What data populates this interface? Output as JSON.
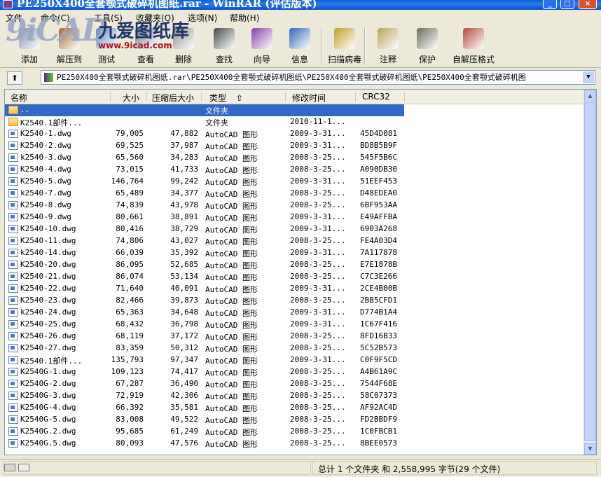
{
  "window": {
    "title": "PE250X400全套颚式破碎机图纸.rar - WinRAR (评估版本)"
  },
  "menu": [
    "文件",
    "命令(C)",
    "工具(S)",
    "收藏夹(O)",
    "选项(N)",
    "帮助(H)"
  ],
  "watermark": {
    "brand": "9iCAD",
    "name": "九爱图纸库",
    "url": "www.9icad.com"
  },
  "toolbar": {
    "buttons": [
      {
        "label": "添加",
        "icon": "add-icon",
        "color": "#7b8fb0"
      },
      {
        "label": "解压到",
        "icon": "extract-icon",
        "color": "#a36a2b"
      },
      {
        "label": "测试",
        "icon": "test-icon",
        "color": "#5f86c4"
      },
      {
        "label": "查看",
        "icon": "view-icon",
        "color": "#6a7f96"
      },
      {
        "label": "删除",
        "icon": "delete-icon",
        "color": "#8e8e8e"
      },
      {
        "label": "查找",
        "icon": "find-icon",
        "color": "#4a4a4a"
      },
      {
        "label": "向导",
        "icon": "wizard-icon",
        "color": "#8a3fa6"
      },
      {
        "label": "信息",
        "icon": "info-icon",
        "color": "#2f66b8"
      },
      {
        "label": "扫描病毒",
        "icon": "scan-virus-icon",
        "color": "#c49b2b"
      },
      {
        "label": "注释",
        "icon": "comment-icon",
        "color": "#b8a35a"
      },
      {
        "label": "保护",
        "icon": "protect-icon",
        "color": "#6b6b5a"
      },
      {
        "label": "自解压格式",
        "icon": "sfx-icon",
        "color": "#b34a3a"
      }
    ]
  },
  "address": {
    "path": "PE250X400全套颚式破碎机图纸.rar\\PE250X400全套颚式破碎机图纸\\PE250X400全套颚式破碎机图纸\\PE250X400全套颚式破碎机图"
  },
  "columns": [
    "名称",
    "大小",
    "压缩后大小",
    "类型",
    "修改时间",
    "CRC32"
  ],
  "files": [
    {
      "name": "..",
      "size": "",
      "packed": "",
      "type": "文件夹",
      "date": "",
      "crc": "",
      "icon": "folder",
      "selected": true
    },
    {
      "name": "K2540.1部件...",
      "size": "",
      "packed": "",
      "type": "文件夹",
      "date": "2010-11-1...",
      "crc": "",
      "icon": "folder"
    },
    {
      "name": "K2540-1.dwg",
      "size": "79,005",
      "packed": "47,882",
      "type": "AutoCAD 图形",
      "date": "2009-3-31...",
      "crc": "45D4D081",
      "icon": "dwg"
    },
    {
      "name": "K2540-2.dwg",
      "size": "69,525",
      "packed": "37,987",
      "type": "AutoCAD 图形",
      "date": "2009-3-31...",
      "crc": "BD8B5B9F",
      "icon": "dwg"
    },
    {
      "name": "k2540-3.dwg",
      "size": "65,560",
      "packed": "34,283",
      "type": "AutoCAD 图形",
      "date": "2008-3-25...",
      "crc": "545F5B6C",
      "icon": "dwg"
    },
    {
      "name": "K2540-4.dwg",
      "size": "73,015",
      "packed": "41,733",
      "type": "AutoCAD 图形",
      "date": "2008-3-25...",
      "crc": "A090DB30",
      "icon": "dwg"
    },
    {
      "name": "K2540-5.dwg",
      "size": "146,764",
      "packed": "99,242",
      "type": "AutoCAD 图形",
      "date": "2009-3-31...",
      "crc": "51EEF453",
      "icon": "dwg"
    },
    {
      "name": "k2540-7.dwg",
      "size": "65,489",
      "packed": "34,377",
      "type": "AutoCAD 图形",
      "date": "2008-3-25...",
      "crc": "D48EDEA0",
      "icon": "dwg"
    },
    {
      "name": "K2540-8.dwg",
      "size": "74,839",
      "packed": "43,978",
      "type": "AutoCAD 图形",
      "date": "2008-3-25...",
      "crc": "6BF953AA",
      "icon": "dwg"
    },
    {
      "name": "K2540-9.dwg",
      "size": "80,661",
      "packed": "38,891",
      "type": "AutoCAD 图形",
      "date": "2009-3-31...",
      "crc": "E49AFFBA",
      "icon": "dwg"
    },
    {
      "name": "K2540-10.dwg",
      "size": "80,416",
      "packed": "38,729",
      "type": "AutoCAD 图形",
      "date": "2009-3-31...",
      "crc": "6903A268",
      "icon": "dwg"
    },
    {
      "name": "K2540-11.dwg",
      "size": "74,806",
      "packed": "43,027",
      "type": "AutoCAD 图形",
      "date": "2008-3-25...",
      "crc": "FE4A03D4",
      "icon": "dwg"
    },
    {
      "name": "k2540-14.dwg",
      "size": "66,039",
      "packed": "35,392",
      "type": "AutoCAD 图形",
      "date": "2009-3-31...",
      "crc": "7A117878",
      "icon": "dwg"
    },
    {
      "name": "K2540-20.dwg",
      "size": "86,095",
      "packed": "52,685",
      "type": "AutoCAD 图形",
      "date": "2008-3-25...",
      "crc": "E7E1878B",
      "icon": "dwg"
    },
    {
      "name": "K2540-21.dwg",
      "size": "86,074",
      "packed": "53,134",
      "type": "AutoCAD 图形",
      "date": "2008-3-25...",
      "crc": "C7C3E266",
      "icon": "dwg"
    },
    {
      "name": "K2540-22.dwg",
      "size": "71,640",
      "packed": "40,091",
      "type": "AutoCAD 图形",
      "date": "2009-3-31...",
      "crc": "2CE4B00B",
      "icon": "dwg"
    },
    {
      "name": "K2540-23.dwg",
      "size": "82,466",
      "packed": "39,873",
      "type": "AutoCAD 图形",
      "date": "2008-3-25...",
      "crc": "2BB5CFD1",
      "icon": "dwg"
    },
    {
      "name": "k2540-24.dwg",
      "size": "65,363",
      "packed": "34,648",
      "type": "AutoCAD 图形",
      "date": "2009-3-31...",
      "crc": "D774B1A4",
      "icon": "dwg"
    },
    {
      "name": "K2540-25.dwg",
      "size": "68,432",
      "packed": "36,798",
      "type": "AutoCAD 图形",
      "date": "2009-3-31...",
      "crc": "1C67F416",
      "icon": "dwg"
    },
    {
      "name": "K2540-26.dwg",
      "size": "68,119",
      "packed": "37,172",
      "type": "AutoCAD 图形",
      "date": "2008-3-25...",
      "crc": "8FD16B33",
      "icon": "dwg"
    },
    {
      "name": "K2540-27.dwg",
      "size": "83,359",
      "packed": "50,312",
      "type": "AutoCAD 图形",
      "date": "2008-3-25...",
      "crc": "5C52B573",
      "icon": "dwg"
    },
    {
      "name": "K2540.1部件...",
      "size": "135,793",
      "packed": "97,347",
      "type": "AutoCAD 图形",
      "date": "2009-3-31...",
      "crc": "C0F9F5CD",
      "icon": "dwg"
    },
    {
      "name": "K2540G-1.dwg",
      "size": "109,123",
      "packed": "74,417",
      "type": "AutoCAD 图形",
      "date": "2008-3-25...",
      "crc": "A4B61A9C",
      "icon": "dwg"
    },
    {
      "name": "K2540G-2.dwg",
      "size": "67,287",
      "packed": "36,490",
      "type": "AutoCAD 图形",
      "date": "2008-3-25...",
      "crc": "7544F68E",
      "icon": "dwg"
    },
    {
      "name": "K2540G-3.dwg",
      "size": "72,919",
      "packed": "42,306",
      "type": "AutoCAD 图形",
      "date": "2008-3-25...",
      "crc": "58C07373",
      "icon": "dwg"
    },
    {
      "name": "K2540G-4.dwg",
      "size": "66,392",
      "packed": "35,581",
      "type": "AutoCAD 图形",
      "date": "2008-3-25...",
      "crc": "AF92AC4D",
      "icon": "dwg"
    },
    {
      "name": "K2540G-5.dwg",
      "size": "83,008",
      "packed": "49,522",
      "type": "AutoCAD 图形",
      "date": "2008-3-25...",
      "crc": "FD2BBDF9",
      "icon": "dwg"
    },
    {
      "name": "K2540G.2.dwg",
      "size": "95,685",
      "packed": "61,249",
      "type": "AutoCAD 图形",
      "date": "2008-3-25...",
      "crc": "1C0FBCB1",
      "icon": "dwg"
    },
    {
      "name": "K2540G.5.dwg",
      "size": "80,093",
      "packed": "47,576",
      "type": "AutoCAD 图形",
      "date": "2008-3-25...",
      "crc": "8BEE0573",
      "icon": "dwg"
    }
  ],
  "status": {
    "text": "总计 1 个文件夹 和 2,558,995 字节(29 个文件)"
  }
}
